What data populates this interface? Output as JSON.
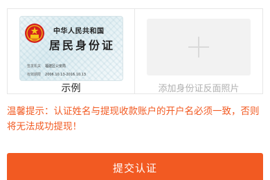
{
  "id_sample": {
    "country": "中华人民共和国",
    "title": "居民身份证",
    "authority_label": "签发机关",
    "authority_value": "福建区公安局",
    "validity_label": "有效期限",
    "validity_value": "2006.10.13-2016.10.13",
    "caption": "示例"
  },
  "upload": {
    "icon": "plus-icon",
    "caption": "添加身份证反面照片"
  },
  "tip": {
    "text": "温馨提示：认证姓名与提现收款账户的开户名必须一致，否则将无法成功提现！"
  },
  "submit": {
    "label": "提交认证"
  },
  "colors": {
    "accent": "#f25a22",
    "border": "#e6e6e6",
    "placeholder_bg": "#f2f2f2",
    "muted_text": "#b0b0b0"
  }
}
